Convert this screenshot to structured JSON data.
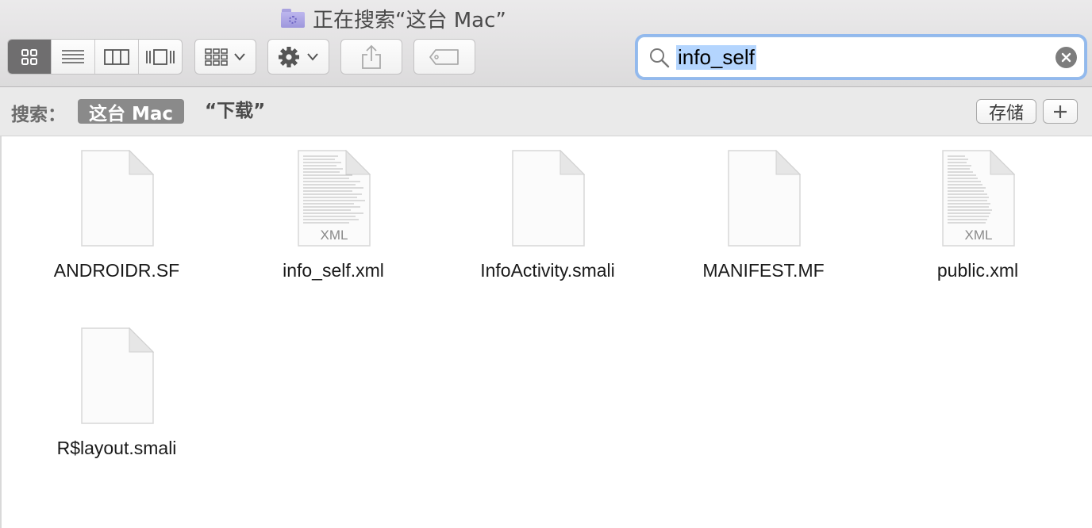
{
  "window": {
    "title": "正在搜索“这台 Mac”"
  },
  "toolbar": {
    "view_modes": [
      {
        "name": "icon-view",
        "active": true
      },
      {
        "name": "list-view",
        "active": false
      },
      {
        "name": "column-view",
        "active": false
      },
      {
        "name": "cover-flow-view",
        "active": false
      }
    ],
    "group_button": "grid-group-icon",
    "action_button": "gear-icon",
    "share_button": "share-icon",
    "tag_button": "tag-icon"
  },
  "search": {
    "value": "info_self",
    "accent_color": "#92b9ee",
    "selection_color": "#b4d5fe"
  },
  "scope": {
    "label": "搜索：",
    "active": "这台 Mac",
    "option": "“下载”",
    "save_label": "存储",
    "add_label": "+"
  },
  "files": [
    {
      "name": "ANDROIDR.SF",
      "icon": "blank-document-icon",
      "kind": "blank"
    },
    {
      "name": "info_self.xml",
      "icon": "xml-document-icon",
      "kind": "xml",
      "badge": "XML"
    },
    {
      "name": "InfoActivity.smali",
      "icon": "blank-document-icon",
      "kind": "blank"
    },
    {
      "name": "MANIFEST.MF",
      "icon": "blank-document-icon",
      "kind": "blank"
    },
    {
      "name": "public.xml",
      "icon": "xml-document-icon",
      "kind": "xml",
      "badge": "XML"
    },
    {
      "name": "R$layout.smali",
      "icon": "blank-document-icon",
      "kind": "blank"
    }
  ]
}
